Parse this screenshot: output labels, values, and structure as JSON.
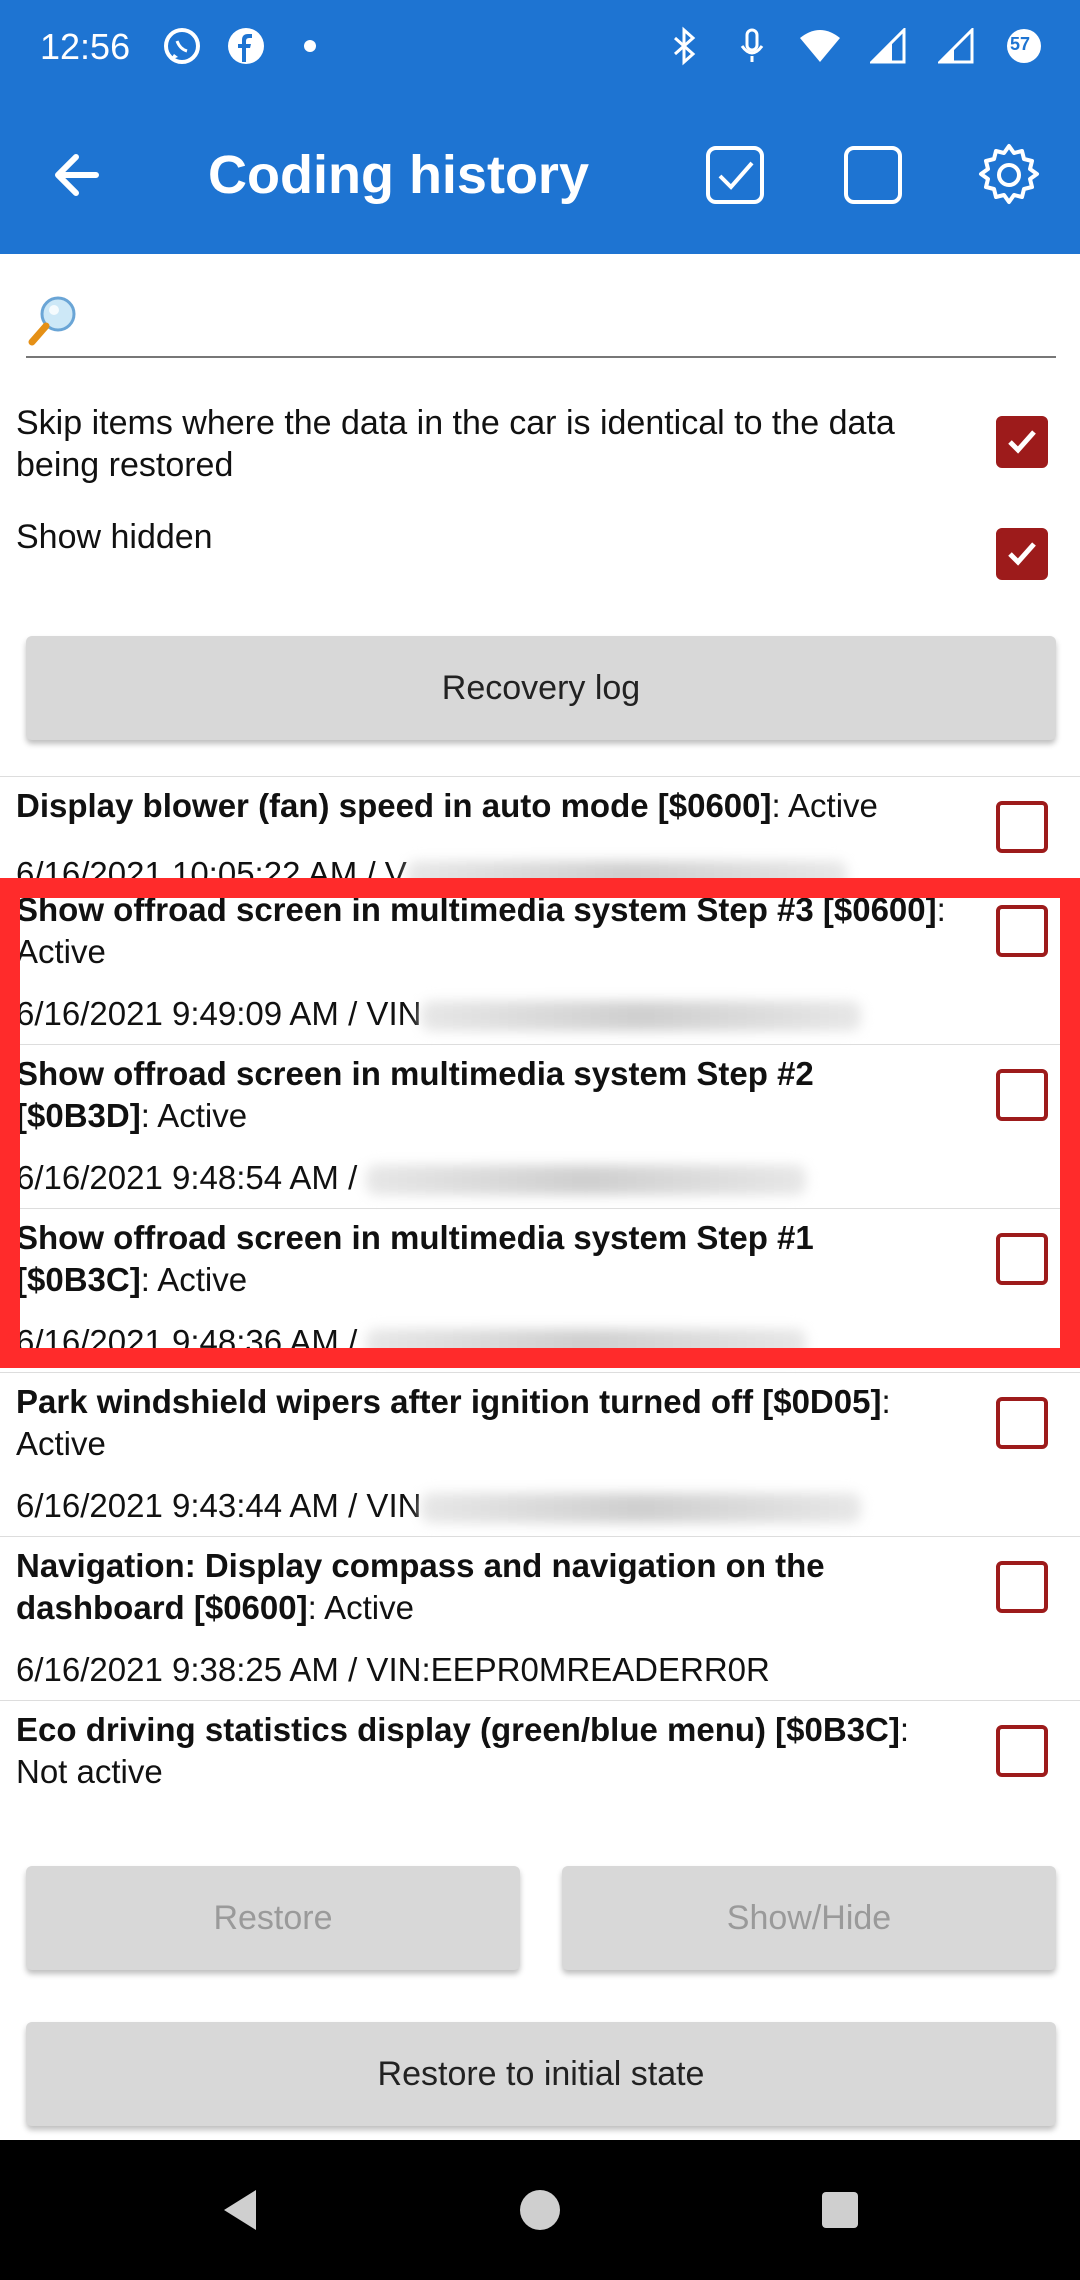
{
  "status_bar": {
    "time": "12:56",
    "badge": "57",
    "icons_left": [
      "whatsapp-icon",
      "facebook-icon",
      "dot-icon"
    ],
    "icons_right": [
      "bluetooth-icon",
      "mic-icon",
      "wifi-icon",
      "signal-icon",
      "signal-icon",
      "battery-icon"
    ]
  },
  "app_bar": {
    "title": "Coding history",
    "back_icon": "arrow-left-icon",
    "select_all_icon": "checkbox-checked-icon",
    "deselect_all_icon": "checkbox-empty-icon",
    "settings_icon": "gear-icon"
  },
  "search": {
    "placeholder": "",
    "value": ""
  },
  "options": {
    "skip_identical": {
      "label": "Skip items where the data in the car is identical to the data being restored",
      "checked": true
    },
    "show_hidden": {
      "label": "Show hidden",
      "checked": true
    }
  },
  "buttons": {
    "recovery_log": "Recovery log",
    "restore": "Restore",
    "show_hide": "Show/Hide",
    "restore_initial": "Restore to initial state"
  },
  "history": [
    {
      "name": "Display blower (fan) speed in auto mode [$0600]",
      "status": ": Active",
      "timestamp": "6/16/2021 10:05:22 AM / V",
      "checked": false
    },
    {
      "name": "Show offroad screen in multimedia system Step #3 [$0600]",
      "status": ": Active",
      "timestamp": "6/16/2021 9:49:09 AM / VIN",
      "checked": false
    },
    {
      "name": "Show offroad screen in multimedia system Step #2 [$0B3D]",
      "status": ": Active",
      "timestamp": "6/16/2021 9:48:54 AM / ",
      "checked": false
    },
    {
      "name": "Show offroad screen in multimedia system Step #1 [$0B3C]",
      "status": ": Active",
      "timestamp": "6/16/2021 9:48:36 AM / ",
      "checked": false
    },
    {
      "name": "Park windshield wipers after ignition turned off [$0D05]",
      "status": ": Active",
      "timestamp": "6/16/2021 9:43:44 AM / VIN",
      "checked": false
    },
    {
      "name": "Navigation: Display compass and navigation on the dashboard [$0600]",
      "status": ": Active",
      "timestamp": "6/16/2021 9:38:25 AM / VIN:EEPR0MREADERR0R",
      "checked": false
    },
    {
      "name": "Eco driving statistics display (green/blue menu) [$0B3C]",
      "status": ": Not active",
      "timestamp": "",
      "checked": false
    }
  ],
  "colors": {
    "primary": "#1e74d2",
    "checkbox": "#9d1b1b",
    "highlight": "#ff2b2b",
    "button_bg": "#d8d8d8"
  }
}
